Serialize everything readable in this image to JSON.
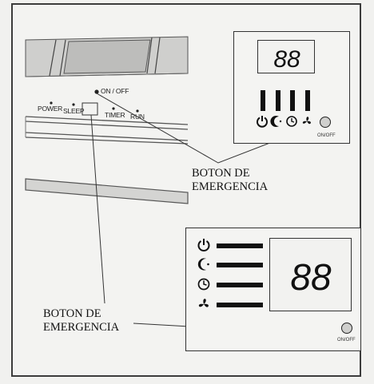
{
  "unit_labels": {
    "power": "POWER",
    "sleep": "SLEEP",
    "timer": "TIMER",
    "run": "RUN",
    "on_off": "ON / OFF"
  },
  "callouts": {
    "right_line1": "BOTON DE",
    "right_line2": "EMERGENCIA",
    "left_line1": "BOTON DE",
    "left_line2": "EMERGENCIA"
  },
  "panel_top": {
    "display": "88",
    "button_caption": "ON/OFF",
    "icons": [
      "power-icon",
      "moon-icon",
      "clock-icon",
      "fan-icon"
    ]
  },
  "panel_bottom": {
    "display": "88",
    "button_caption": "ON/OFF",
    "icons": [
      "power-icon",
      "moon-icon",
      "clock-icon",
      "fan-icon"
    ]
  }
}
